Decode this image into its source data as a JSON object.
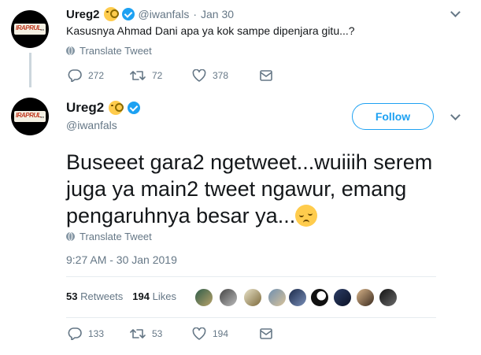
{
  "parent_tweet": {
    "display_name": "Ureg2",
    "handle": "@iwanfals",
    "separator": "·",
    "date": "Jan 30",
    "text": "Kasusnya Ahmad Dani apa ya kok sampe dipenjara gitu...?",
    "translate_label": "Translate Tweet",
    "replies": "272",
    "retweets": "72",
    "likes": "378"
  },
  "main_tweet": {
    "display_name": "Ureg2",
    "handle": "@iwanfals",
    "follow_label": "Follow",
    "text": "Buseeet gara2 ngetweet...wuiiih serem juga ya main2 tweet ngawur, emang pengaruhnya besar ya...",
    "translate_label": "Translate Tweet",
    "timestamp": "9:27 AM - 30 Jan 2019",
    "retweet_count": "53",
    "retweet_label": "Retweets",
    "like_count": "194",
    "like_label": "Likes",
    "replies": "133",
    "retweets": "53",
    "likes": "194"
  },
  "avatar_logo_text": "IRAPRUL",
  "colors": {
    "accent": "#1da1f2",
    "muted": "#657786",
    "text": "#14171a",
    "divider": "#e6ecf0"
  },
  "icons": [
    "monocle-face-emoji",
    "verified-badge-icon",
    "chevron-down-icon",
    "globe-icon",
    "reply-icon",
    "retweet-icon",
    "like-icon",
    "dm-icon",
    "pensive-face-emoji"
  ]
}
